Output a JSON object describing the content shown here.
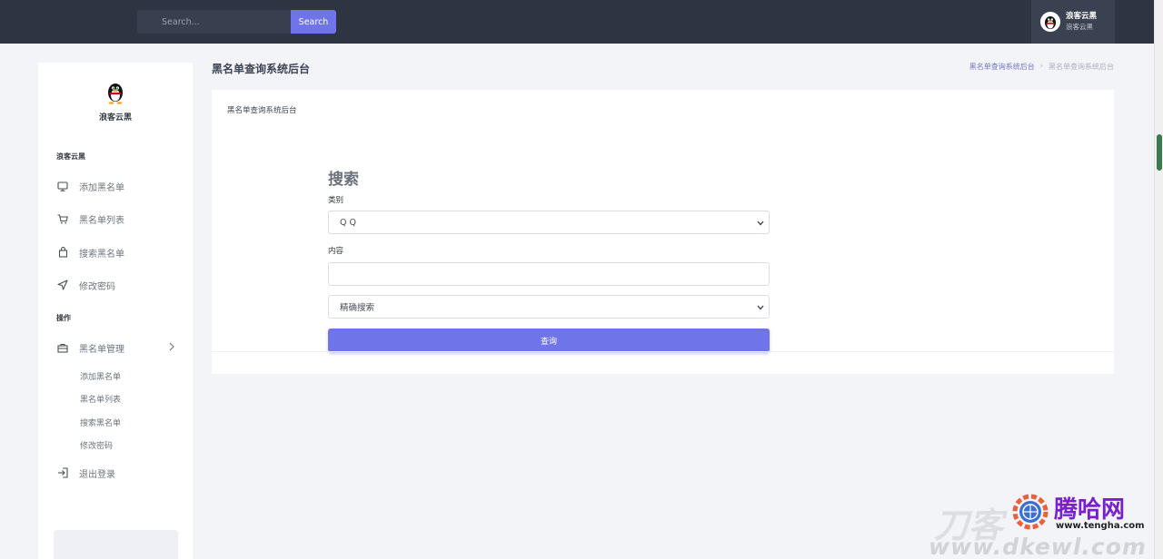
{
  "topbar": {
    "search_placeholder": "Search...",
    "search_button": "Search",
    "user_name": "浪客云黑",
    "user_sub": "浪客云黑"
  },
  "sidebar": {
    "brand_name": "浪客云黑",
    "section1_title": "浪客云黑",
    "items": [
      {
        "label": "添加黑名单",
        "icon": "monitor-icon"
      },
      {
        "label": "黑名单列表",
        "icon": "cart-icon"
      },
      {
        "label": "搜索黑名单",
        "icon": "bag-icon"
      },
      {
        "label": "修改密码",
        "icon": "send-icon"
      }
    ],
    "section2_title": "操作",
    "manage": {
      "label": "黑名单管理",
      "icon": "briefcase-icon",
      "children": [
        "添加黑名单",
        "黑名单列表",
        "搜索黑名单",
        "修改密码"
      ]
    },
    "logout_label": "退出登录"
  },
  "main": {
    "page_title": "黑名单查询系统后台",
    "breadcrumb": [
      "黑名单查询系统后台",
      "›",
      "黑名单查询系统后台"
    ],
    "card_subtitle": "黑名单查询系统后台"
  },
  "form": {
    "heading": "搜索",
    "category_label": "类别",
    "category_value": "Q Q",
    "content_label": "内容",
    "content_value": "",
    "mode_value": "精确搜索",
    "submit_label": "查询"
  },
  "watermark": {
    "site_cn": "腾哈网",
    "site_url": "www.tengha.com",
    "bottom": "www.dkewl.com",
    "left_cn": "刀客"
  },
  "colors": {
    "accent": "#6f75e8",
    "topbar": "#2e3442"
  }
}
